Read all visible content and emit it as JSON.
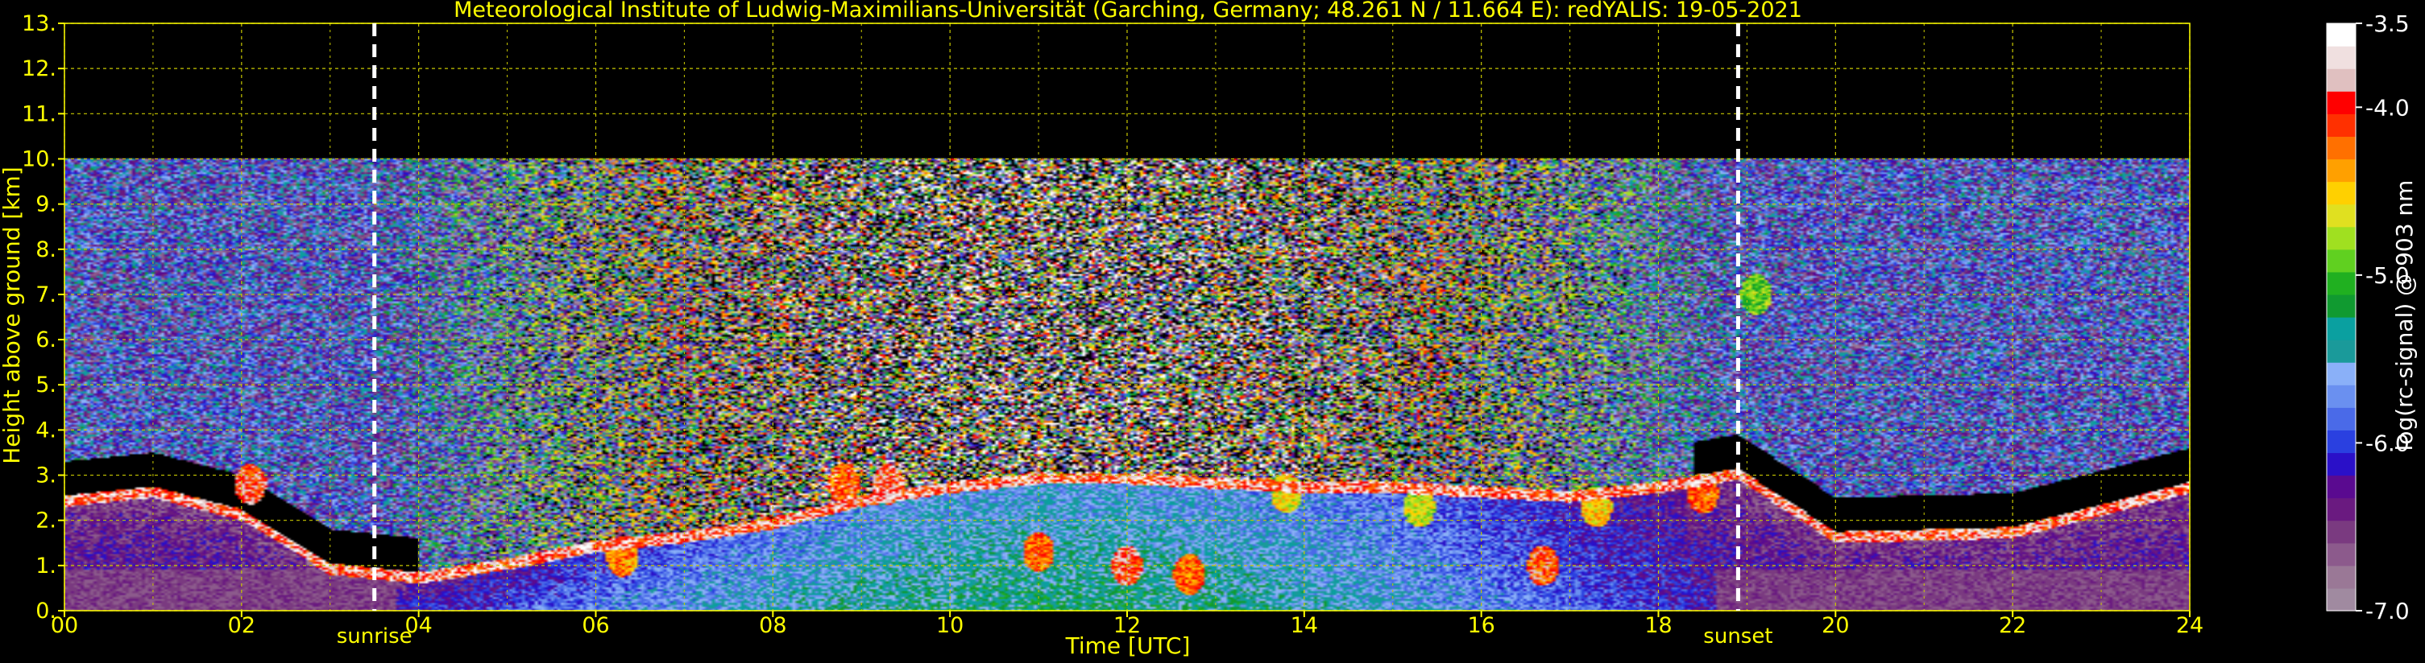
{
  "chart_data": {
    "type": "heatmap",
    "title": "Meteorological Institute of Ludwig-Maximilians-Universität (Garching, Germany; 48.261 N / 11.664 E):    redYALIS: 19-05-2021",
    "xlabel": "Time [UTC]",
    "ylabel": "Height above ground [km]",
    "xlim": [
      0,
      24
    ],
    "ylim": [
      0,
      13
    ],
    "x_ticks": [
      0,
      2,
      4,
      6,
      8,
      10,
      12,
      14,
      16,
      18,
      20,
      22,
      24
    ],
    "x_tick_labels": [
      "00",
      "02",
      "04",
      "06",
      "08",
      "10",
      "12",
      "14",
      "16",
      "18",
      "20",
      "22",
      "24"
    ],
    "y_ticks": [
      0,
      1,
      2,
      3,
      4,
      5,
      6,
      7,
      8,
      9,
      10,
      11,
      12,
      13
    ],
    "y_tick_labels": [
      "0.",
      "1.",
      "2.",
      "3.",
      "4.",
      "5.",
      "6.",
      "7.",
      "8.",
      "9.",
      "10.",
      "11.",
      "12.",
      "13."
    ],
    "grid": true,
    "data_top_km": 10,
    "colorbar": {
      "label": "log(rc-signal) @ 903 nm",
      "range": [
        -7.0,
        -3.5
      ],
      "ticks": [
        -3.5,
        -4.0,
        -5.0,
        -6.0,
        -7.0
      ],
      "tick_labels": [
        "-3.5",
        "-4.0",
        "-5.0",
        "-6.0",
        "-7.0"
      ],
      "colors": [
        "#a08aa0",
        "#9a7896",
        "#8c5a8c",
        "#7a3a80",
        "#6a1a80",
        "#5a0a90",
        "#2a10c8",
        "#2a40e0",
        "#4a6ae8",
        "#6a90f0",
        "#8ab0f8",
        "#1a9a9a",
        "#0aa0a0",
        "#109a30",
        "#20b020",
        "#60d020",
        "#a0e020",
        "#e0e020",
        "#ffd000",
        "#ffa000",
        "#ff7000",
        "#ff3000",
        "#ff0000",
        "#e0c0c0",
        "#f0e0e0",
        "#ffffff"
      ]
    },
    "markers": [
      {
        "label": "sunrise",
        "x": 3.5
      },
      {
        "label": "sunset",
        "x": 18.9
      }
    ],
    "boundary_layer_top_km": [
      [
        0.0,
        2.3
      ],
      [
        1.0,
        2.5
      ],
      [
        2.0,
        2.0
      ],
      [
        3.0,
        0.8
      ],
      [
        4.0,
        0.6
      ],
      [
        5.0,
        0.9
      ],
      [
        6.0,
        1.3
      ],
      [
        7.0,
        1.5
      ],
      [
        8.0,
        1.8
      ],
      [
        9.0,
        2.3
      ],
      [
        10.0,
        2.6
      ],
      [
        11.0,
        2.8
      ],
      [
        12.0,
        2.8
      ],
      [
        13.0,
        2.7
      ],
      [
        14.0,
        2.6
      ],
      [
        15.0,
        2.6
      ],
      [
        16.0,
        2.5
      ],
      [
        17.0,
        2.4
      ],
      [
        18.0,
        2.6
      ],
      [
        18.9,
        2.9
      ],
      [
        20.0,
        1.5
      ],
      [
        22.0,
        1.6
      ],
      [
        24.0,
        2.6
      ]
    ],
    "features": [
      {
        "x": 2.1,
        "y": 2.8,
        "value": -4.0
      },
      {
        "x": 6.3,
        "y": 1.2,
        "value": -4.3
      },
      {
        "x": 8.8,
        "y": 2.8,
        "value": -4.2
      },
      {
        "x": 9.3,
        "y": 2.8,
        "value": -4.0
      },
      {
        "x": 11.0,
        "y": 1.3,
        "value": -4.2
      },
      {
        "x": 12.0,
        "y": 1.0,
        "value": -4.0
      },
      {
        "x": 12.7,
        "y": 0.8,
        "value": -4.2
      },
      {
        "x": 13.8,
        "y": 2.6,
        "value": -4.6
      },
      {
        "x": 15.3,
        "y": 2.3,
        "value": -4.7
      },
      {
        "x": 16.7,
        "y": 1.0,
        "value": -4.1
      },
      {
        "x": 17.3,
        "y": 2.3,
        "value": -4.5
      },
      {
        "x": 18.5,
        "y": 2.6,
        "value": -4.2
      },
      {
        "x": 19.1,
        "y": 7.0,
        "value": -4.9
      }
    ]
  }
}
